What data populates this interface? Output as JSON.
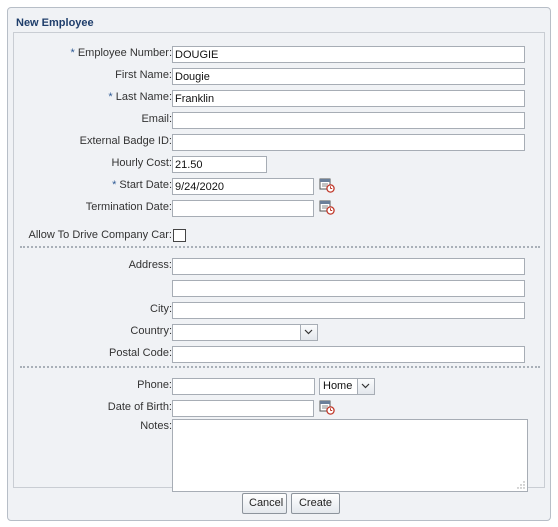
{
  "dialog": {
    "title": "New Employee"
  },
  "form": {
    "employee_number": {
      "label": "Employee Number:",
      "required": "*",
      "value": "DOUGIE"
    },
    "first_name": {
      "label": "First Name:",
      "value": "Dougie"
    },
    "last_name": {
      "label": "Last Name:",
      "required": "*",
      "value": "Franklin"
    },
    "email": {
      "label": "Email:",
      "value": ""
    },
    "external_badge_id": {
      "label": "External Badge ID:",
      "value": ""
    },
    "hourly_cost": {
      "label": "Hourly Cost:",
      "value": "21.50"
    },
    "start_date": {
      "label": "Start Date:",
      "required": "*",
      "value": "9/24/2020"
    },
    "termination_date": {
      "label": "Termination Date:",
      "value": ""
    },
    "allow_company_car": {
      "label": "Allow To Drive Company Car:",
      "checked": false
    },
    "address": {
      "label": "Address:",
      "line1": "",
      "line2": ""
    },
    "city": {
      "label": "City:",
      "value": ""
    },
    "country": {
      "label": "Country:",
      "value": ""
    },
    "postal_code": {
      "label": "Postal Code:",
      "value": ""
    },
    "phone": {
      "label": "Phone:",
      "value": "",
      "type": "Home"
    },
    "date_of_birth": {
      "label": "Date of Birth:",
      "value": ""
    },
    "notes": {
      "label": "Notes:",
      "value": ""
    }
  },
  "buttons": {
    "cancel": "Cancel",
    "create": "Create"
  },
  "icons": {
    "calendar": "calendar-icon",
    "dropdown": "chevron-down-icon",
    "resize": "resize-grip-icon"
  }
}
